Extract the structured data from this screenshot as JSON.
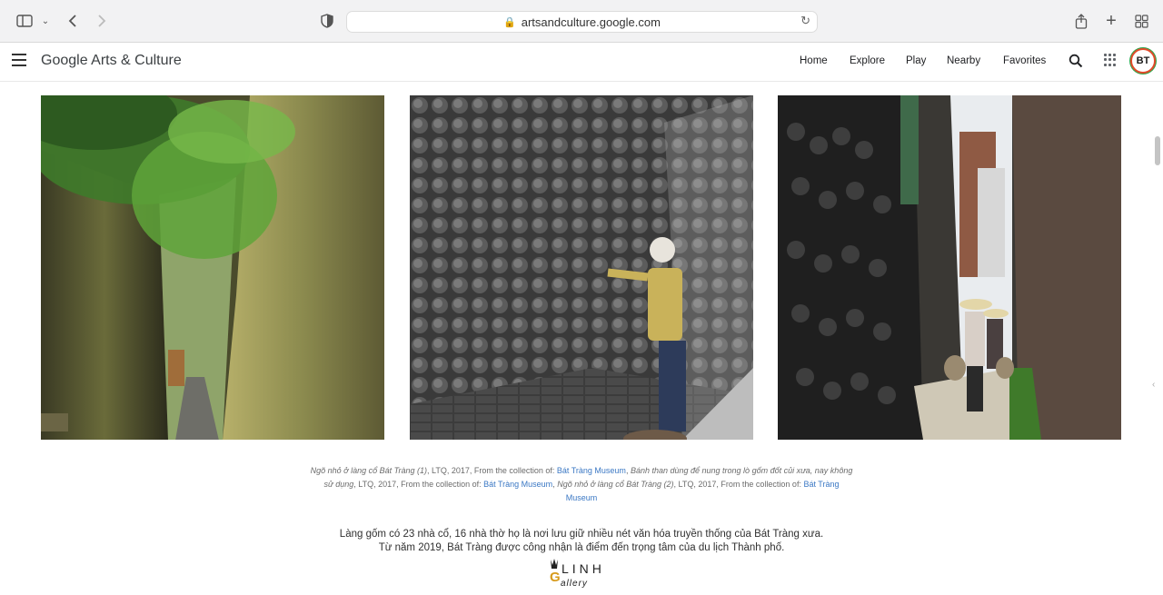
{
  "browser": {
    "url": "artsandculture.google.com"
  },
  "header": {
    "brand": "Google Arts & Culture",
    "nav": [
      "Home",
      "Explore",
      "Play",
      "Nearby",
      "Favorites"
    ],
    "avatar_initials": "BT"
  },
  "caption": {
    "t1": "Ngõ nhỏ ở làng cổ Bát Tràng (1)",
    "m1": ", LTQ, 2017, From the collection of: ",
    "link1": "Bát Tràng Museum",
    "sep1": ", ",
    "t2": "Bánh than dùng để nung trong lò gốm đốt củi xưa, nay không sử dụng",
    "m2": ", LTQ, 2017, From the collection of: ",
    "link2": "Bát Tràng Museum",
    "sep2": ", ",
    "t3": "Ngõ nhỏ ở làng cổ Bát Tràng (2)",
    "m3": ", LTQ, 2017, From the collection of: ",
    "link3": "Bát Tràng Museum"
  },
  "body": {
    "line1": "Làng gốm có 23 nhà cổ, 16 nhà thờ họ là nơi lưu giữ nhiều nét văn hóa truyền thống của Bát Tràng xưa.",
    "line2": "Từ năm 2019, Bát Tràng được công nhận là điểm đến trọng tâm của du lịch Thành phố."
  },
  "logo": {
    "word1": "LINH",
    "word2": "Gallery"
  },
  "colors": {
    "link": "#3b78c4",
    "avatar_ring": "#e24a2a",
    "logo_accent": "#d79a1b"
  }
}
